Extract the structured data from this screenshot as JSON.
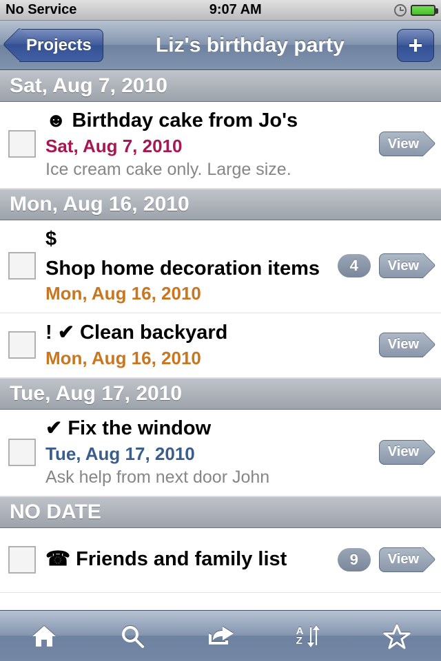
{
  "status": {
    "carrier": "No Service",
    "time": "9:07 AM"
  },
  "nav": {
    "back_label": "Projects",
    "title": "Liz's birthday party",
    "add_label": "+"
  },
  "view_label": "View",
  "sections": [
    {
      "header": "Sat, Aug 7, 2010",
      "tasks": [
        {
          "prefix": "☻",
          "title": "Birthday cake from Jo's",
          "date": "Sat, Aug 7, 2010",
          "date_style": "red",
          "note": "Ice cream cake only. Large size.",
          "count": null
        }
      ]
    },
    {
      "header": "Mon, Aug 16, 2010",
      "tasks": [
        {
          "prefix": "$",
          "title": "Shop home decoration items",
          "date": "Mon, Aug 16, 2010",
          "date_style": "orange",
          "note": null,
          "count": "4"
        },
        {
          "prefix": "! ✔",
          "title": "Clean backyard",
          "date": "Mon, Aug 16, 2010",
          "date_style": "orange",
          "note": null,
          "count": null
        }
      ]
    },
    {
      "header": "Tue, Aug 17, 2010",
      "tasks": [
        {
          "prefix": "✔",
          "title": "Fix the window",
          "date": "Tue, Aug 17, 2010",
          "date_style": "blue",
          "note": "Ask help from next door John",
          "count": null
        }
      ]
    },
    {
      "header": "NO DATE",
      "tasks": [
        {
          "prefix": "☎",
          "title": "Friends and family list",
          "date": null,
          "date_style": null,
          "note": null,
          "count": "9"
        }
      ]
    }
  ],
  "toolbar": {
    "sort_a": "A",
    "sort_z": "Z"
  }
}
